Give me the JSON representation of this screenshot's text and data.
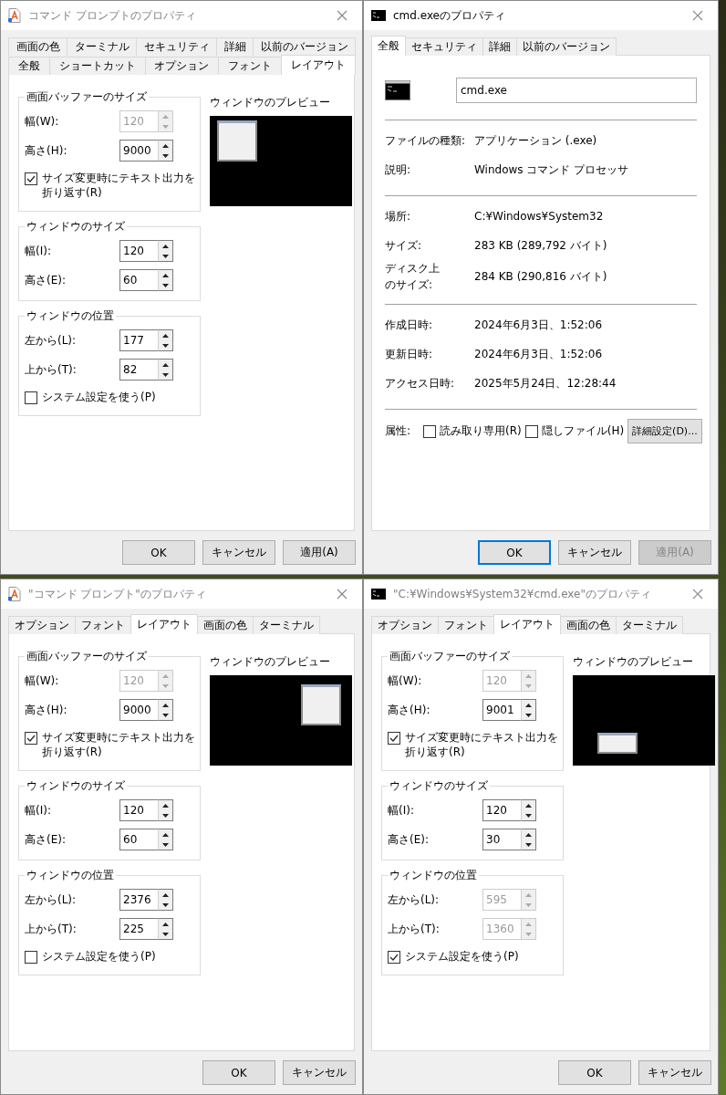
{
  "windows": [
    {
      "kind": "console_layout",
      "title": "コマンド プロンプトのプロパティ",
      "tab_rows": [
        [
          {
            "label": "画面の色",
            "selected": false
          },
          {
            "label": "ターミナル",
            "selected": false
          },
          {
            "label": "セキュリティ",
            "selected": false
          },
          {
            "label": "詳細",
            "selected": false
          },
          {
            "label": "以前のバージョン",
            "selected": false
          }
        ],
        [
          {
            "label": "全般",
            "selected": false
          },
          {
            "label": "ショートカット",
            "selected": false
          },
          {
            "label": "オプション",
            "selected": false
          },
          {
            "label": "フォント",
            "selected": false
          },
          {
            "label": "レイアウト",
            "selected": true
          }
        ]
      ],
      "groups": [
        {
          "title": "画面バッファーのサイズ",
          "fields": [
            {
              "label": "幅(W):",
              "value": "120",
              "disabled": true
            },
            {
              "label": "高さ(H):",
              "value": "9000",
              "disabled": false
            }
          ],
          "checkbox": {
            "label": "サイズ変更時にテキスト出力を折り返す(R)",
            "checked": true
          }
        },
        {
          "title": "ウィンドウのサイズ",
          "fields": [
            {
              "label": "幅(I):",
              "value": "120",
              "disabled": false
            },
            {
              "label": "高さ(E):",
              "value": "60",
              "disabled": false
            }
          ]
        },
        {
          "title": "ウィンドウの位置",
          "fields": [
            {
              "label": "左から(L):",
              "value": "177",
              "disabled": false
            },
            {
              "label": "上から(T):",
              "value": "82",
              "disabled": false
            }
          ],
          "checkbox": {
            "label": "システム設定を使う(P)",
            "checked": false
          }
        }
      ],
      "preview": {
        "title": "ウィンドウのプレビュー"
      },
      "buttons": [
        {
          "label": "OK",
          "default": false,
          "disabled": false
        },
        {
          "label": "キャンセル",
          "default": false,
          "disabled": false
        },
        {
          "label": "適用(A)",
          "default": false,
          "disabled": false
        }
      ]
    },
    {
      "kind": "file_general",
      "title": "cmd.exeのプロパティ",
      "tab_rows": [
        [
          {
            "label": "全般",
            "selected": true
          },
          {
            "label": "セキュリティ",
            "selected": false
          },
          {
            "label": "詳細",
            "selected": false
          },
          {
            "label": "以前のバージョン",
            "selected": false
          }
        ]
      ],
      "name": "cmd.exe",
      "sections": [
        [
          {
            "label": "ファイルの種類:",
            "value": "アプリケーション (.exe)"
          },
          {
            "label": "説明:",
            "value": "Windows コマンド プロセッサ"
          }
        ],
        [
          {
            "label": "場所:",
            "value": "C:¥Windows¥System32"
          },
          {
            "label": "サイズ:",
            "value": "283 KB (289,792 バイト)"
          },
          {
            "label": "ディスク上のサイズ:",
            "value": "284 KB (290,816 バイト)"
          }
        ],
        [
          {
            "label": "作成日時:",
            "value": "2024年6月3日、1:52:06"
          },
          {
            "label": "更新日時:",
            "value": "2024年6月3日、1:52:06"
          },
          {
            "label": "アクセス日時:",
            "value": "2025年5月24日、12:28:44"
          }
        ]
      ],
      "attributes": {
        "label": "属性:",
        "checkboxes": [
          {
            "label": "読み取り専用(R)",
            "checked": false
          },
          {
            "label": "隠しファイル(H)",
            "checked": false
          }
        ],
        "button": "詳細設定(D)..."
      },
      "buttons": [
        {
          "label": "OK",
          "default": true,
          "disabled": false
        },
        {
          "label": "キャンセル",
          "default": false,
          "disabled": false
        },
        {
          "label": "適用(A)",
          "default": false,
          "disabled": true
        }
      ]
    },
    {
      "kind": "console_layout",
      "title": "\"コマンド プロンプト\"のプロパティ",
      "tab_rows": [
        [
          {
            "label": "オプション",
            "selected": false
          },
          {
            "label": "フォント",
            "selected": false
          },
          {
            "label": "レイアウト",
            "selected": true
          },
          {
            "label": "画面の色",
            "selected": false
          },
          {
            "label": "ターミナル",
            "selected": false
          }
        ]
      ],
      "groups": [
        {
          "title": "画面バッファーのサイズ",
          "fields": [
            {
              "label": "幅(W):",
              "value": "120",
              "disabled": true
            },
            {
              "label": "高さ(H):",
              "value": "9000",
              "disabled": false
            }
          ],
          "checkbox": {
            "label": "サイズ変更時にテキスト出力を折り返す(R)",
            "checked": true
          }
        },
        {
          "title": "ウィンドウのサイズ",
          "fields": [
            {
              "label": "幅(I):",
              "value": "120",
              "disabled": false
            },
            {
              "label": "高さ(E):",
              "value": "60",
              "disabled": false
            }
          ]
        },
        {
          "title": "ウィンドウの位置",
          "fields": [
            {
              "label": "左から(L):",
              "value": "2376",
              "disabled": false
            },
            {
              "label": "上から(T):",
              "value": "225",
              "disabled": false
            }
          ],
          "checkbox": {
            "label": "システム設定を使う(P)",
            "checked": false
          }
        }
      ],
      "preview": {
        "title": "ウィンドウのプレビュー"
      },
      "buttons": [
        {
          "label": "OK",
          "default": false,
          "disabled": false
        },
        {
          "label": "キャンセル",
          "default": false,
          "disabled": false
        }
      ]
    },
    {
      "kind": "console_layout",
      "title": "\"C:¥Windows¥System32¥cmd.exe\"のプロパティ",
      "tab_rows": [
        [
          {
            "label": "オプション",
            "selected": false
          },
          {
            "label": "フォント",
            "selected": false
          },
          {
            "label": "レイアウト",
            "selected": true
          },
          {
            "label": "画面の色",
            "selected": false
          },
          {
            "label": "ターミナル",
            "selected": false
          }
        ]
      ],
      "groups": [
        {
          "title": "画面バッファーのサイズ",
          "fields": [
            {
              "label": "幅(W):",
              "value": "120",
              "disabled": true
            },
            {
              "label": "高さ(H):",
              "value": "9001",
              "disabled": false
            }
          ],
          "checkbox": {
            "label": "サイズ変更時にテキスト出力を折り返す(R)",
            "checked": true
          }
        },
        {
          "title": "ウィンドウのサイズ",
          "fields": [
            {
              "label": "幅(I):",
              "value": "120",
              "disabled": false
            },
            {
              "label": "高さ(E):",
              "value": "30",
              "disabled": false
            }
          ]
        },
        {
          "title": "ウィンドウの位置",
          "fields": [
            {
              "label": "左から(L):",
              "value": "595",
              "disabled": true
            },
            {
              "label": "上から(T):",
              "value": "1360",
              "disabled": true
            }
          ],
          "checkbox": {
            "label": "システム設定を使う(P)",
            "checked": true
          }
        }
      ],
      "preview": {
        "title": "ウィンドウのプレビュー"
      },
      "buttons": [
        {
          "label": "OK",
          "default": false,
          "disabled": false
        },
        {
          "label": "キャンセル",
          "default": false,
          "disabled": false
        }
      ]
    }
  ]
}
